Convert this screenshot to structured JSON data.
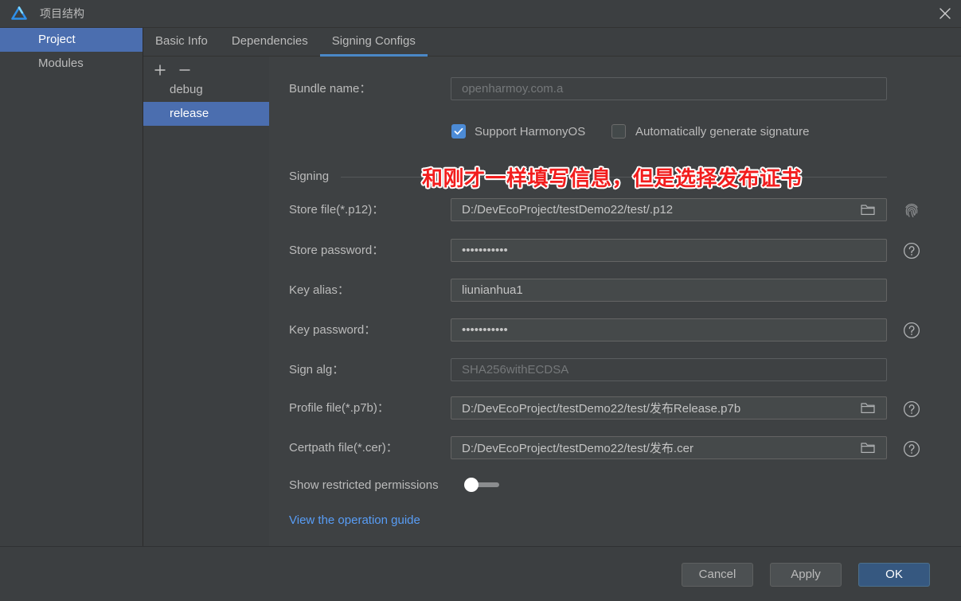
{
  "window": {
    "title": "项目结构"
  },
  "sidebar": {
    "items": [
      {
        "label": "Project",
        "selected": true
      },
      {
        "label": "Modules",
        "selected": false
      }
    ]
  },
  "tabs": [
    {
      "label": "Basic Info",
      "selected": false
    },
    {
      "label": "Dependencies",
      "selected": false
    },
    {
      "label": "Signing Configs",
      "selected": true
    }
  ],
  "configs": {
    "items": [
      {
        "label": "debug",
        "selected": false
      },
      {
        "label": "release",
        "selected": true
      }
    ]
  },
  "form": {
    "bundle_name": {
      "label": "Bundle name：",
      "value": "openharmoy.com.a",
      "disabled": true
    },
    "support_harmonyos": {
      "label": "Support HarmonyOS",
      "checked": true
    },
    "auto_generate_signature": {
      "label": "Automatically generate signature",
      "checked": false
    },
    "signing_section": {
      "title": "Signing"
    },
    "store_file": {
      "label": "Store file(*.p12)：",
      "value": "D:/DevEcoProject/testDemo22/test/.p12"
    },
    "store_password": {
      "label": "Store password：",
      "value": "•••••••••••"
    },
    "key_alias": {
      "label": "Key alias：",
      "value": "liunianhua1"
    },
    "key_password": {
      "label": "Key password：",
      "value": "•••••••••••"
    },
    "sign_alg": {
      "label": "Sign alg：",
      "value": "SHA256withECDSA",
      "disabled": true
    },
    "profile_file": {
      "label": "Profile file(*.p7b)：",
      "value": "D:/DevEcoProject/testDemo22/test/发布Release.p7b"
    },
    "certpath_file": {
      "label": "Certpath file(*.cer)：",
      "value": "D:/DevEcoProject/testDemo22/test/发布.cer"
    },
    "show_restricted_permissions": {
      "label": "Show restricted permissions",
      "enabled": false
    },
    "operation_guide_link": "View the operation guide"
  },
  "annotation": {
    "text": "和刚才一样填写信息，但是选择发布证书"
  },
  "footer": {
    "cancel": "Cancel",
    "apply": "Apply",
    "ok": "OK"
  },
  "icons": {
    "logo": "deveco-logo-icon",
    "close": "close-icon",
    "add": "plus-icon",
    "remove": "minus-icon",
    "folder": "folder-icon",
    "fingerprint": "fingerprint-icon",
    "help": "help-icon",
    "check": "checkmark-icon"
  },
  "colors": {
    "selection": "#4b6eaf",
    "tab_underline": "#4a88c7",
    "checkbox": "#4c8bd6",
    "link": "#589df6",
    "annotation": "#f21d1d",
    "ok_button": "#365880"
  }
}
